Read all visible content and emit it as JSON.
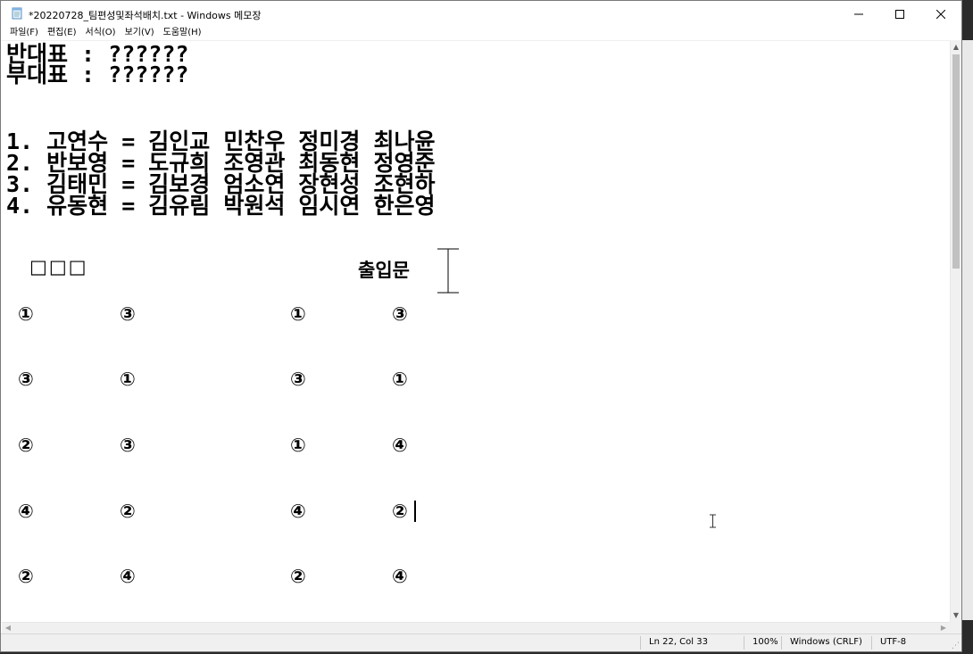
{
  "window": {
    "title": "*20220728_팀편성및좌석배치.txt - Windows 메모장",
    "controls": {
      "minimize": "—",
      "maximize": "☐",
      "close": "✕"
    }
  },
  "menu": [
    "파일(F)",
    "편집(E)",
    "서식(O)",
    "보기(V)",
    "도움말(H)"
  ],
  "document": {
    "lines": [
      "반대표 : ??????",
      "부대표 : ??????",
      "1. 고연수 = 김인교 민찬우 정미경 최나윤",
      "2. 반보영 = 도규희 조영관 최동현 정영준",
      "3. 김태민 = 김보경 엄소연 장현성 조현하",
      "4. 유동현 = 김유림 박원석 임시연 한은영"
    ],
    "boxes": "□□□",
    "entrance_label": "출입문",
    "seat_rows": [
      [
        "①",
        "③",
        "①",
        "③"
      ],
      [
        "③",
        "①",
        "③",
        "①"
      ],
      [
        "②",
        "③",
        "①",
        "④"
      ],
      [
        "④",
        "②",
        "④",
        "②"
      ],
      [
        "②",
        "④",
        "②",
        "④"
      ]
    ]
  },
  "status": {
    "position": "Ln 22, Col 33",
    "zoom": "100%",
    "line_ending": "Windows (CRLF)",
    "encoding": "UTF-8"
  },
  "icons": {
    "app": "notepad-icon",
    "entrance": "door-marker-icon",
    "cursor": "ibeam-cursor-icon"
  }
}
